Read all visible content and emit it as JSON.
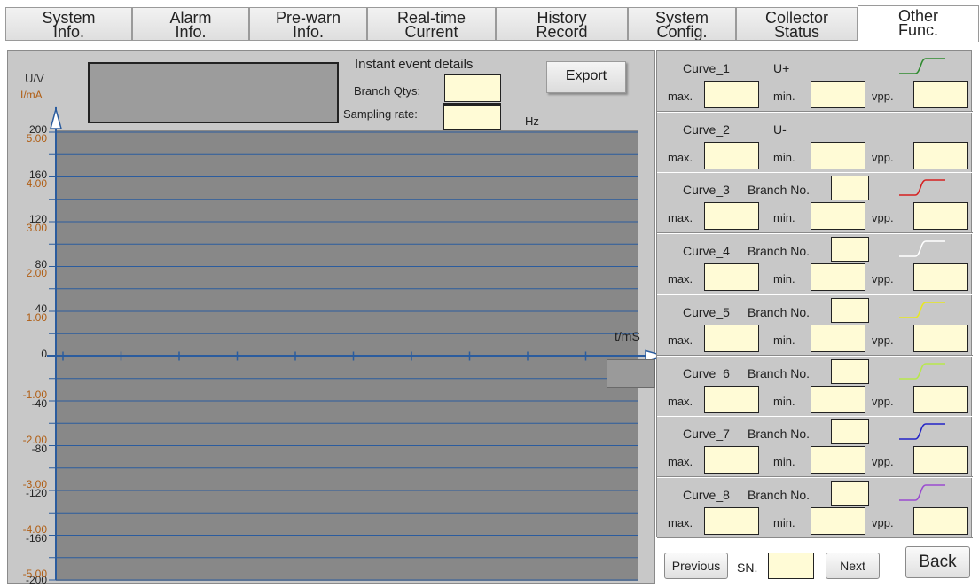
{
  "tabs": [
    {
      "label": "System\nInfo."
    },
    {
      "label": "Alarm\nInfo."
    },
    {
      "label": "Pre-warn\nInfo."
    },
    {
      "label": "Real-time\nCurrent"
    },
    {
      "label": "History\nRecord"
    },
    {
      "label": "System\nConfig."
    },
    {
      "label": "Collector\nStatus"
    },
    {
      "label": "Other\nFunc."
    }
  ],
  "event": {
    "title": "Instant event details",
    "branch_qtys_label": "Branch Qtys:",
    "sampling_rate_label": "Sampling rate:",
    "hz_label": "Hz",
    "export_label": "Export"
  },
  "chart_data": {
    "type": "line",
    "y_axis_u": {
      "label": "U/V",
      "ticks": [
        "200",
        "160",
        "120",
        "80",
        "40",
        "0",
        "-40",
        "-80",
        "-120",
        "-160",
        "-200"
      ],
      "ylim": [
        -200,
        200
      ]
    },
    "y_axis_i": {
      "label": "I/mA",
      "ticks": [
        "5.00",
        "4.00",
        "3.00",
        "2.00",
        "1.00",
        "-1.00",
        "-2.00",
        "-3.00",
        "-4.00",
        "-5.00"
      ],
      "ylim": [
        -5,
        5
      ]
    },
    "x_axis": {
      "label": "t/mS"
    },
    "series": [],
    "grid": true
  },
  "curves": [
    {
      "name": "Curve_1",
      "sub": "U+",
      "branch": false,
      "color": "#2f8a2f"
    },
    {
      "name": "Curve_2",
      "sub": "U-",
      "branch": false,
      "color": ""
    },
    {
      "name": "Curve_3",
      "sub": "Branch No.",
      "branch": true,
      "color": "#d62020"
    },
    {
      "name": "Curve_4",
      "sub": "Branch No.",
      "branch": true,
      "color": "#ffffff"
    },
    {
      "name": "Curve_5",
      "sub": "Branch No.",
      "branch": true,
      "color": "#e8e820"
    },
    {
      "name": "Curve_6",
      "sub": "Branch No.",
      "branch": true,
      "color": "#b8e84a"
    },
    {
      "name": "Curve_7",
      "sub": "Branch No.",
      "branch": true,
      "color": "#2222c8"
    },
    {
      "name": "Curve_8",
      "sub": "Branch No.",
      "branch": true,
      "color": "#9a4ad0"
    }
  ],
  "stats_labels": {
    "max": "max.",
    "min": "min.",
    "vpp": "vpp."
  },
  "nav": {
    "previous": "Previous",
    "sn": "SN.",
    "next": "Next",
    "back": "Back"
  }
}
